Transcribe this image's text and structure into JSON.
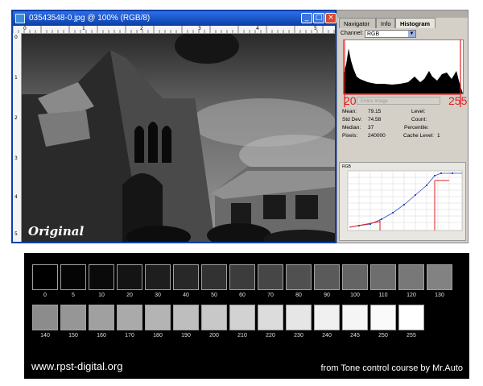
{
  "document_window": {
    "title": "03543548-0.jpg @ 100% (RGB/8)",
    "buttons": {
      "minimize": "_",
      "maximize": "□",
      "close": "×"
    },
    "ruler_top": [
      "0",
      "1",
      "2",
      "3",
      "4",
      "5"
    ],
    "ruler_left": [
      "0",
      "1",
      "2",
      "3",
      "4",
      "5"
    ],
    "caption": "Original"
  },
  "palette": {
    "tabs": [
      "Navigator",
      "Info",
      "Histogram"
    ],
    "active_tab": "Histogram",
    "channel_label": "Channel:",
    "channel_value": "RGB",
    "source_value": "Entire Image",
    "marker_low": "20",
    "marker_high": "255",
    "stats": {
      "mean_label": "Mean:",
      "mean": "79.15",
      "stddev_label": "Std Dev:",
      "stddev": "74.58",
      "median_label": "Median:",
      "median": "37",
      "pixels_label": "Pixels:",
      "pixels": "240000",
      "level_label": "Level:",
      "level": "",
      "count_label": "Count:",
      "count": "",
      "percentile_label": "Percentile:",
      "percentile": "",
      "cache_label": "Cache Level:",
      "cache": "1"
    },
    "curves_label": "RGB",
    "accent_color": "#e02020"
  },
  "tone_strip": {
    "row1": [
      "0",
      "5",
      "10",
      "20",
      "30",
      "40",
      "50",
      "60",
      "70",
      "80",
      "90",
      "100",
      "110",
      "120",
      "130"
    ],
    "row2": [
      "140",
      "150",
      "160",
      "170",
      "180",
      "190",
      "200",
      "210",
      "220",
      "230",
      "240",
      "245",
      "250",
      "255"
    ],
    "footer_left": "www.rpst-digital.org",
    "footer_right": "from Tone control course by Mr.Auto"
  }
}
